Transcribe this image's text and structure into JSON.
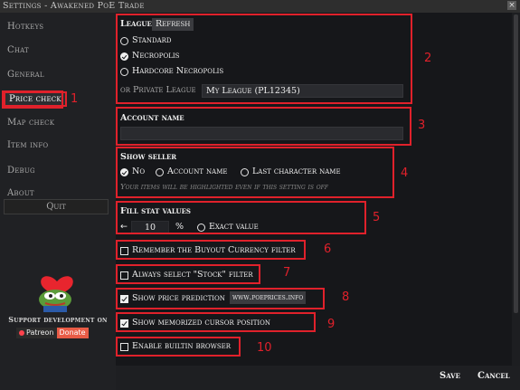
{
  "window": {
    "title": "Settings - Awakened PoE Trade",
    "close": "×"
  },
  "sidebar": {
    "items": [
      {
        "label": "Hotkeys"
      },
      {
        "label": "Chat"
      },
      {
        "label": "General"
      },
      {
        "label": "Price check"
      },
      {
        "label": "Map check"
      },
      {
        "label": "Item info"
      },
      {
        "label": "Debug"
      },
      {
        "label": "About"
      }
    ],
    "quit": "Quit",
    "support": "Support development on",
    "patreon": "Patreon",
    "donate": "Donate"
  },
  "league": {
    "label": "League",
    "refresh": "Refresh",
    "options": [
      "Standard",
      "Necropolis",
      "Hardcore Necropolis"
    ],
    "selected": "Necropolis",
    "private_label": "or Private League",
    "private_value": "My League (PL12345)"
  },
  "account": {
    "label": "Account name",
    "value": ""
  },
  "seller": {
    "label": "Show seller",
    "options": [
      "No",
      "Account name",
      "Last character name"
    ],
    "selected": "No",
    "note": "Your items will be highlighted even if this setting is off"
  },
  "fill": {
    "label": "Fill stat values",
    "arrow": "←",
    "value": "10",
    "unit": "%",
    "exact": "Exact value"
  },
  "checkboxes": [
    {
      "label": "Remember the Buyout Currency filter",
      "checked": false
    },
    {
      "label": "Always select \"Stock\" filter",
      "checked": false
    },
    {
      "label": "Show price prediction",
      "checked": true,
      "link": "www.poeprices.info"
    },
    {
      "label": "Show memorized cursor position",
      "checked": true
    },
    {
      "label": "Enable builtin browser",
      "checked": false
    }
  ],
  "footer": {
    "save": "Save",
    "cancel": "Cancel"
  },
  "annotations": [
    "1",
    "2",
    "3",
    "4",
    "5",
    "6",
    "7",
    "8",
    "9",
    "10"
  ],
  "colors": {
    "annotation_red": "#e0212b",
    "background": "#16171a",
    "sidebar": "#202124"
  }
}
